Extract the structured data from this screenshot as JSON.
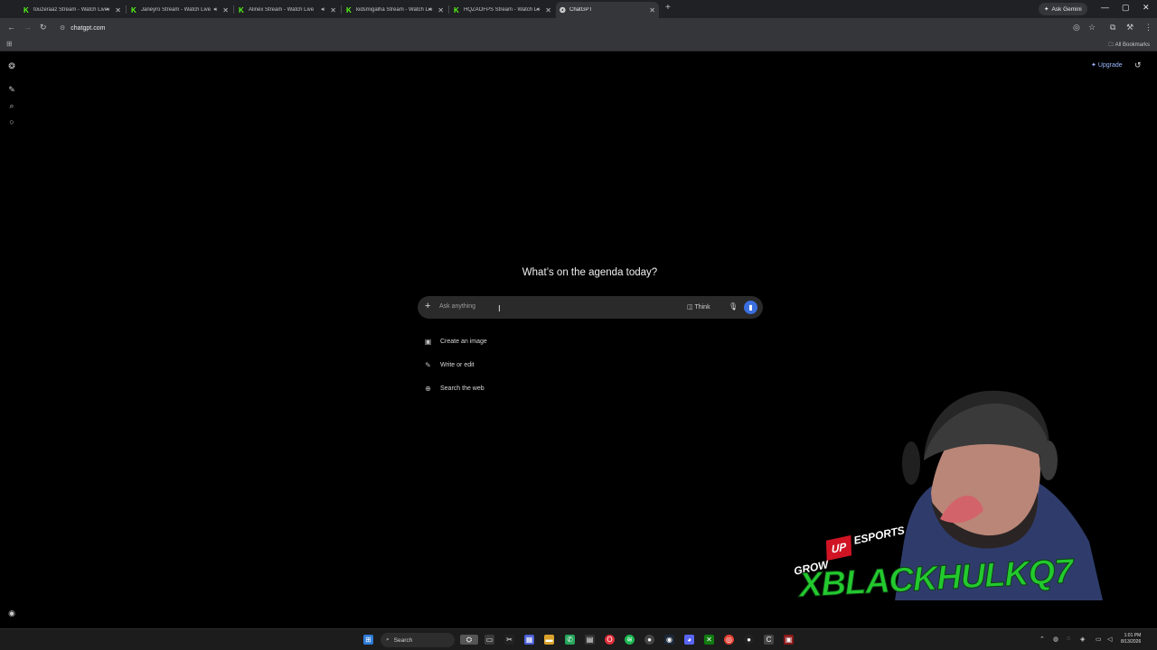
{
  "browser": {
    "tabs": [
      {
        "title": "touzeraaz Stream - Watch Live",
        "sound": true
      },
      {
        "title": "Janeyro Stream - Watch Live",
        "sound": true
      },
      {
        "title": "Alinex Stream - Watch Live",
        "sound": true
      },
      {
        "title": "kidsmigalha Stream - Watch Live",
        "sound": true
      },
      {
        "title": "HQZAOFPS Stream - Watch Live",
        "sound": true
      },
      {
        "title": "ChatGPT",
        "sound": false,
        "active": true
      }
    ],
    "ask_gemini": "Ask Gemini",
    "url": "chatgpt.com",
    "all_bookmarks": "All Bookmarks"
  },
  "chatgpt": {
    "upgrade": "Upgrade",
    "headline": "What’s on the agenda today?",
    "composer": {
      "placeholder": "Ask anything",
      "think": "Think"
    },
    "suggestions": [
      {
        "icon": "image-icon",
        "label": "Create an image"
      },
      {
        "icon": "pencil-icon",
        "label": "Write or edit"
      },
      {
        "icon": "globe-icon",
        "label": "Search the web"
      }
    ]
  },
  "overlay": {
    "grow": "GROW",
    "up": "UP",
    "esports": "ESPORTS",
    "streamer": "XBLACKHULKQ7"
  },
  "taskbar": {
    "search": "Search",
    "time": "1:01 PM",
    "date": "8/13/2026"
  },
  "colors": {
    "accent": "#3b6fe0",
    "kick_green": "#53fc18",
    "upgrade": "#9bb7ff"
  }
}
